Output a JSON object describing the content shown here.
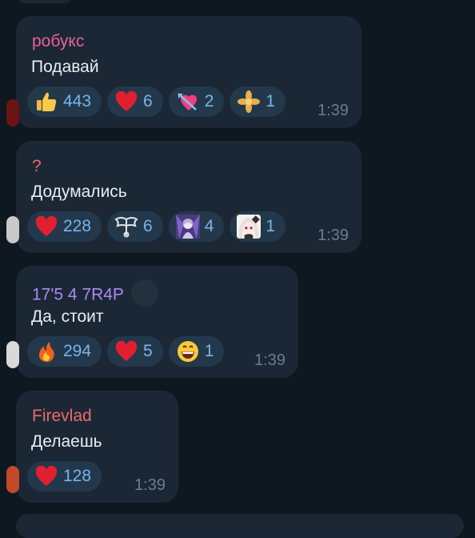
{
  "messages": [
    {
      "sender": "робукс",
      "sender_color": "#e8609c",
      "text": "Подавай",
      "time": "1:39",
      "reactions": [
        {
          "icon": "thumbs-up-emoji",
          "count": "443"
        },
        {
          "icon": "red-heart-emoji",
          "count": "6"
        },
        {
          "icon": "heart-with-arrow-emoji",
          "count": "2"
        },
        {
          "icon": "golden-leaf-sticker",
          "count": "1"
        }
      ]
    },
    {
      "sender": "?",
      "sender_color": "#ec6a70",
      "text": "Додумались",
      "time": "1:39",
      "reactions": [
        {
          "icon": "red-heart-emoji",
          "count": "228"
        },
        {
          "icon": "winged-key-sticker",
          "count": "6"
        },
        {
          "icon": "anime-character-sticker",
          "count": "4"
        },
        {
          "icon": "anime-girl-sticker",
          "count": "1"
        }
      ]
    },
    {
      "sender": "17'5 4 7R4P",
      "sender_color": "#a98af0",
      "text": "Да, стоит",
      "time": "1:39",
      "reactions": [
        {
          "icon": "fire-emoji",
          "count": "294"
        },
        {
          "icon": "red-heart-emoji",
          "count": "5"
        },
        {
          "icon": "grinning-face-emoji",
          "count": "1"
        }
      ]
    },
    {
      "sender": "Firevlad",
      "sender_color": "#ec6a70",
      "text": "Делаешь",
      "time": "1:39",
      "reactions": [
        {
          "icon": "red-heart-emoji",
          "count": "128"
        }
      ]
    }
  ]
}
